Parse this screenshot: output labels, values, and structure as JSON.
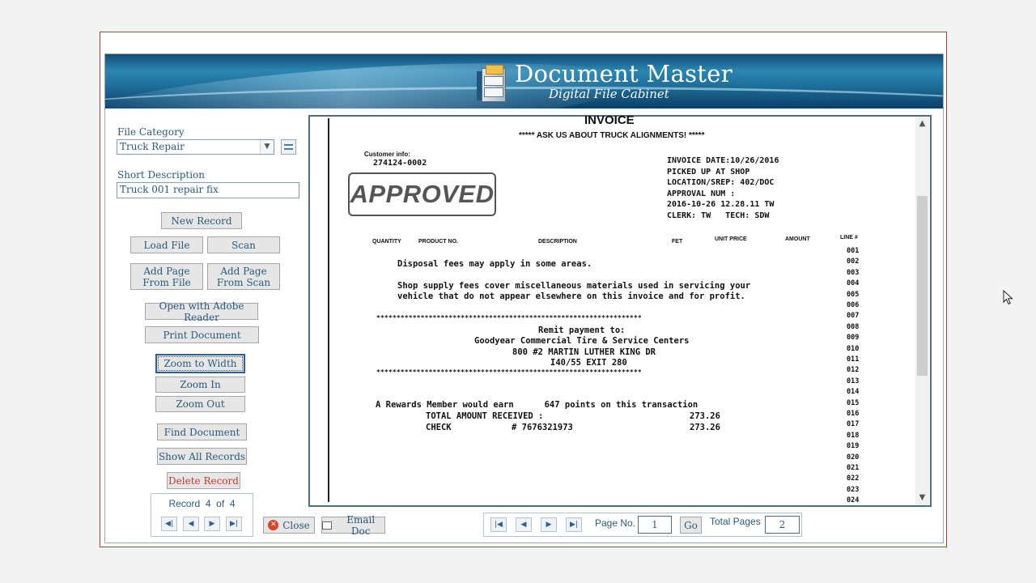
{
  "header": {
    "title": "Document Master",
    "subtitle": "Digital File Cabinet"
  },
  "form": {
    "file_category_label": "File Category",
    "file_category_value": "Truck Repair",
    "short_description_label": "Short Description",
    "short_description_value": "Truck 001 repair fix"
  },
  "buttons": {
    "new_record": "New Record",
    "load_file": "Load File",
    "scan": "Scan",
    "add_page_from_file": "Add Page From File",
    "add_page_from_scan": "Add Page From Scan",
    "open_adobe": "Open with Adobe Reader",
    "print_document": "Print Document",
    "zoom_to_width": "Zoom to Width",
    "zoom_in": "Zoom In",
    "zoom_out": "Zoom Out",
    "find_document": "Find Document",
    "show_all_records": "Show All Records",
    "delete_record": "Delete Record",
    "close": "Close",
    "email_doc": "Email Doc",
    "go": "Go"
  },
  "record_nav": {
    "label": "Record",
    "current": "4",
    "of": "of",
    "total": "4"
  },
  "page_nav": {
    "page_no_label": "Page No.",
    "page_no": "1",
    "total_pages_label": "Total Pages",
    "total_pages": "2"
  },
  "icons": {
    "close": "close-x-icon",
    "email": "email-icon",
    "first": "first-icon",
    "prev": "prev-icon",
    "next": "next-icon",
    "last": "last-icon"
  },
  "document": {
    "heading": "INVOICE",
    "tagline": "***** ASK US ABOUT TRUCK ALIGNMENTS! *****",
    "customer_info_label": "Customer info:",
    "customer_number": "274124-0002",
    "stamp": "APPROVED",
    "invoice_lines": [
      "INVOICE DATE:10/26/2016",
      "PICKED UP AT SHOP",
      "LOCATION/SREP: 402/DOC",
      "APPROVAL NUM :",
      "2016-10-26 12.28.11 TW",
      "CLERK: TW   TECH: SDW"
    ],
    "columns": [
      "QUANTITY",
      "PRODUCT NO.",
      "DESCRIPTION",
      "FET",
      "UNIT PRICE",
      "AMOUNT",
      "LINE #"
    ],
    "line_numbers": [
      "001",
      "002",
      "003",
      "004",
      "005",
      "006",
      "007",
      "008",
      "009",
      "010",
      "011",
      "012",
      "013",
      "014",
      "015",
      "016",
      "017",
      "018",
      "019",
      "020",
      "021",
      "022",
      "023",
      "024"
    ],
    "body_lines": [
      "Disposal fees may apply in some areas.",
      "Shop supply fees cover miscellaneous materials used in servicing your",
      "vehicle that do not appear elsewhere on this invoice and for profit."
    ],
    "stars": "******************************************************************",
    "remit_lines": [
      "Remit payment to:",
      "Goodyear Commercial Tire & Service Centers",
      "800 #2 MARTIN LUTHER KING DR",
      "I40/55 EXIT 280"
    ],
    "rewards_line": "A Rewards Member would earn      647 points on this transaction",
    "total_label": "TOTAL AMOUNT RECEIVED :",
    "total_value": "273.26",
    "check_label": "CHECK",
    "check_number": "# 7676321973",
    "check_value": "273.26"
  }
}
